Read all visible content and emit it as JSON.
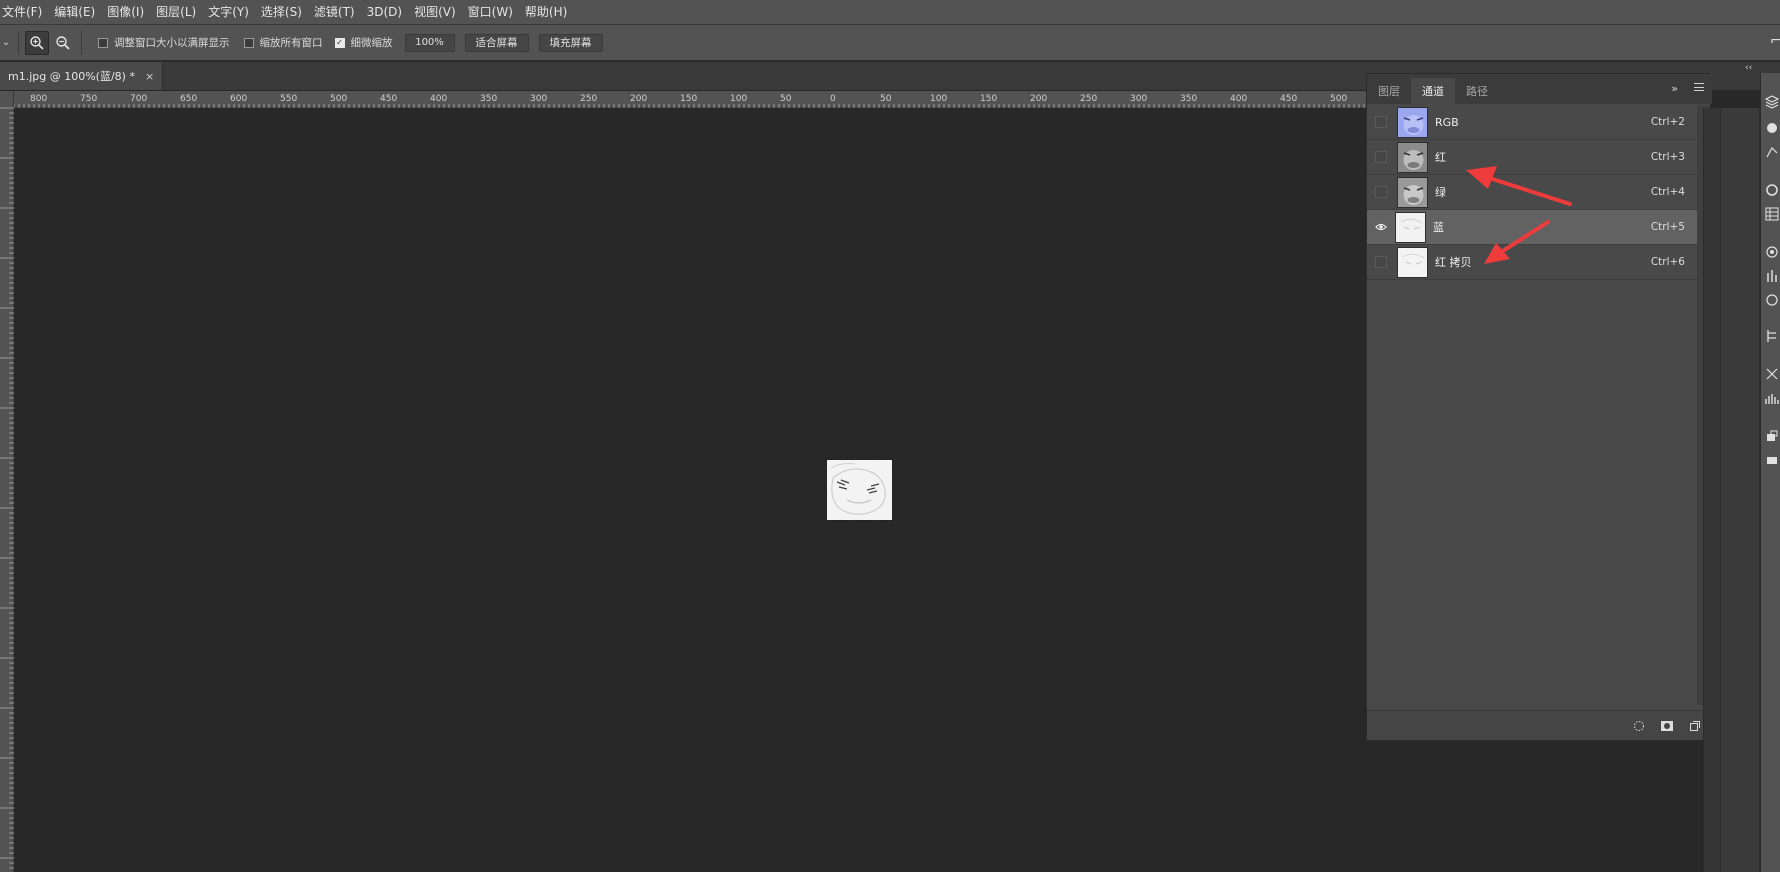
{
  "menubar": {
    "items": [
      "文件(F)",
      "编辑(E)",
      "图像(I)",
      "图层(L)",
      "文字(Y)",
      "选择(S)",
      "滤镜(T)",
      "3D(D)",
      "视图(V)",
      "窗口(W)",
      "帮助(H)"
    ]
  },
  "options": {
    "resize_windows_label": "调整窗口大小以满屏显示",
    "resize_windows_checked": false,
    "zoom_all_label": "缩放所有窗口",
    "zoom_all_checked": false,
    "scrubby_zoom_label": "细微缩放",
    "scrubby_zoom_checked": true,
    "zoom_value": "100%",
    "fit_screen_label": "适合屏幕",
    "fill_screen_label": "填充屏幕"
  },
  "document": {
    "tab_title": "m1.jpg @ 100%(蓝/8) *",
    "close_glyph": "×"
  },
  "ruler": {
    "h_labels": [
      "800",
      "750",
      "700",
      "650",
      "600",
      "550",
      "500",
      "450",
      "400",
      "350",
      "300",
      "250",
      "200",
      "150",
      "100",
      "50",
      "0",
      "50",
      "100",
      "150",
      "200",
      "250",
      "300",
      "350",
      "400",
      "450",
      "500"
    ]
  },
  "channels_panel": {
    "tabs": [
      "图层",
      "通道",
      "路径"
    ],
    "active_tab": 1,
    "expand_glyph": "»",
    "channels": [
      {
        "name": "RGB",
        "shortcut": "Ctrl+2",
        "visible": false,
        "selected": false,
        "thumb": "color"
      },
      {
        "name": "红",
        "shortcut": "Ctrl+3",
        "visible": false,
        "selected": false,
        "thumb": "gray"
      },
      {
        "name": "绿",
        "shortcut": "Ctrl+4",
        "visible": false,
        "selected": false,
        "thumb": "gray"
      },
      {
        "name": "蓝",
        "shortcut": "Ctrl+5",
        "visible": true,
        "selected": true,
        "thumb": "light"
      },
      {
        "name": "红 拷贝",
        "shortcut": "Ctrl+6",
        "visible": false,
        "selected": false,
        "thumb": "light"
      }
    ]
  },
  "colors": {
    "menubar_bg": "#535353",
    "canvas_bg": "#282828",
    "panel_bg": "#494949",
    "selected_row": "#626262",
    "annotation_red": "#ee3b3b"
  }
}
